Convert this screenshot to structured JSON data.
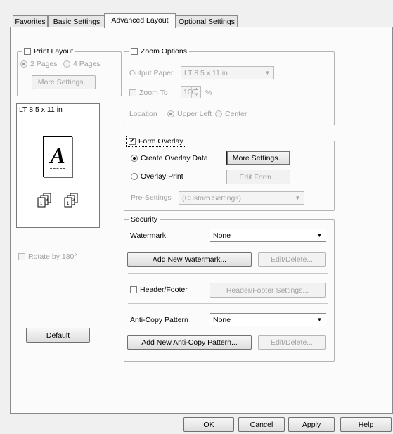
{
  "tabs": [
    "Favorites",
    "Basic Settings",
    "Advanced Layout",
    "Optional Settings"
  ],
  "print_layout": {
    "label": "Print Layout",
    "options": [
      "2 Pages",
      "4 Pages"
    ],
    "more_settings": "More Settings..."
  },
  "preview": {
    "paper": "LT 8.5 x 11 in",
    "letter": "A"
  },
  "rotate_label": "Rotate by 180°",
  "default_button": "Default",
  "zoom": {
    "label": "Zoom Options",
    "output_paper_label": "Output Paper",
    "output_paper_value": "LT 8.5 x 11 in",
    "zoom_to_label": "Zoom To",
    "zoom_value": "100",
    "percent": "%",
    "location_label": "Location",
    "locations": [
      "Upper Left",
      "Center"
    ]
  },
  "form_overlay": {
    "label": "Form Overlay",
    "create_label": "Create Overlay Data",
    "more_settings": "More Settings...",
    "overlay_print_label": "Overlay Print",
    "edit_form": "Edit Form...",
    "presettings_label": "Pre-Settings",
    "presettings_value": "(Custom Settings)"
  },
  "security": {
    "label": "Security",
    "watermark_label": "Watermark",
    "watermark_value": "None",
    "add_watermark": "Add New Watermark...",
    "edit_delete": "Edit/Delete...",
    "header_footer_label": "Header/Footer",
    "header_footer_settings": "Header/Footer Settings...",
    "anticopy_label": "Anti-Copy Pattern",
    "anticopy_value": "None",
    "add_anticopy": "Add New Anti-Copy Pattern...",
    "edit_delete_2": "Edit/Delete..."
  },
  "footer": {
    "ok": "OK",
    "cancel": "Cancel",
    "apply": "Apply",
    "help": "Help"
  }
}
